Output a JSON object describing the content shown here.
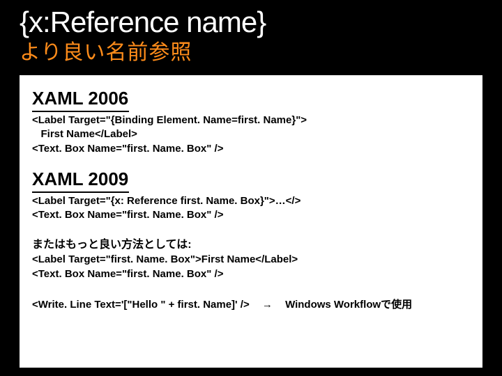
{
  "title_en": "{x:Reference name}",
  "title_ja": "より良い名前参照",
  "section2006": {
    "heading": "XAML 2006",
    "code": "<Label Target=\"{Binding Element. Name=first. Name}\">\n   First Name</Label>\n<Text. Box Name=\"first. Name. Box\" />"
  },
  "section2009": {
    "heading": "XAML 2009",
    "code": "<Label Target=\"{x: Reference first. Name. Box}\">…</>\n<Text. Box Name=\"first. Name. Box\" />"
  },
  "alt": {
    "note": "またはもっと良い方法としては:",
    "code": "<Label Target=\"first. Name. Box\">First Name</Label>\n<Text. Box Name=\"first. Name. Box\" />"
  },
  "lastline": {
    "left": "<Write. Line Text='[\"Hello \" + first. Name]' />",
    "arrow": "→",
    "right": "Windows Workflowで使用"
  }
}
